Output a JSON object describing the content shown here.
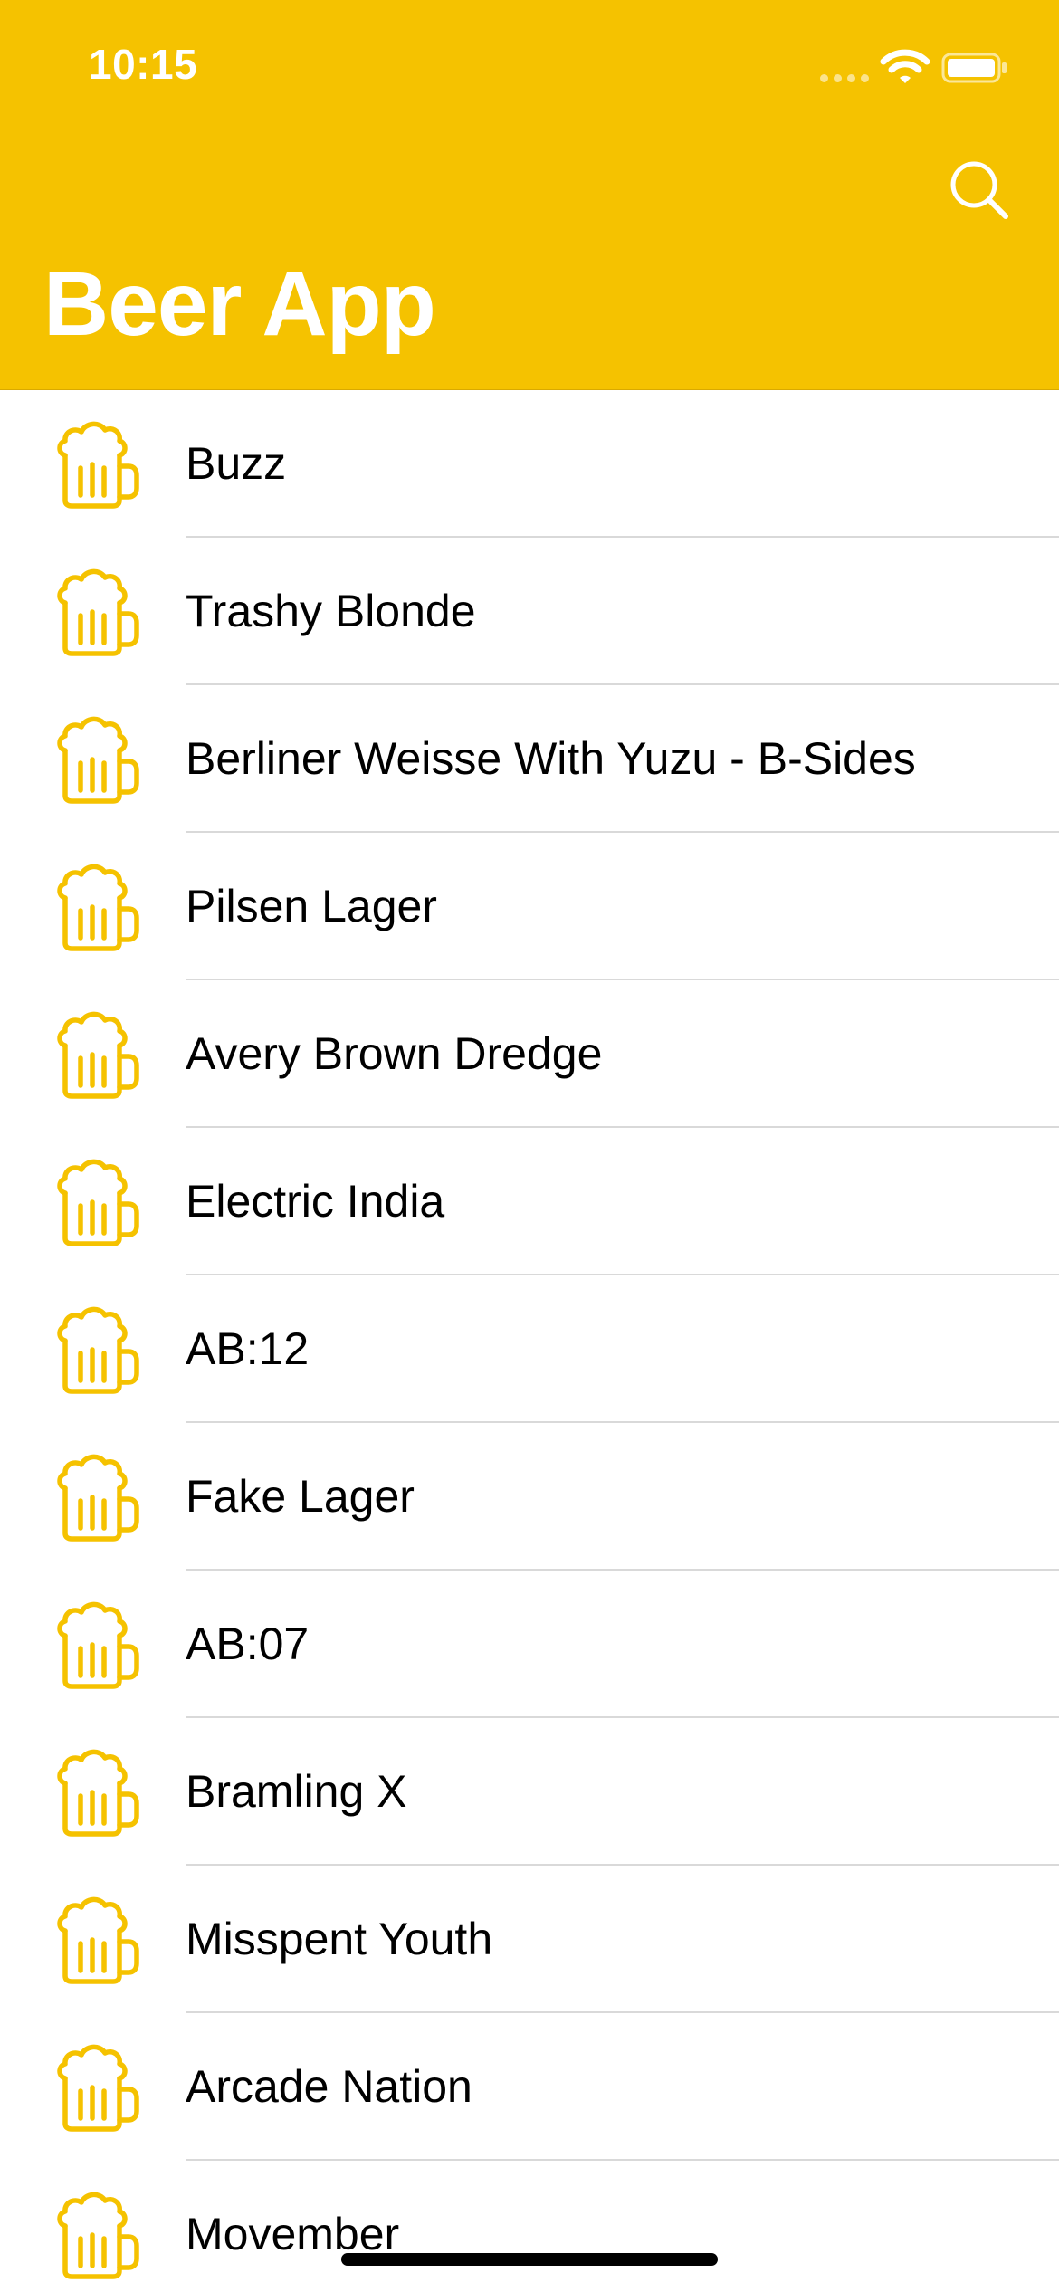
{
  "status_bar": {
    "time": "10:15",
    "signal_icon": "cellular-signal-icon",
    "wifi_icon": "wifi-icon",
    "battery_icon": "battery-icon"
  },
  "nav": {
    "title": "Beer App",
    "search_icon": "search-icon",
    "background_color": "#F5C200",
    "title_color": "#FFFFFF"
  },
  "beers": [
    {
      "name": "Buzz",
      "icon": "beer-mug-icon"
    },
    {
      "name": "Trashy Blonde",
      "icon": "beer-mug-icon"
    },
    {
      "name": "Berliner Weisse With Yuzu - B-Sides",
      "icon": "beer-mug-icon"
    },
    {
      "name": "Pilsen Lager",
      "icon": "beer-mug-icon"
    },
    {
      "name": "Avery Brown Dredge",
      "icon": "beer-mug-icon"
    },
    {
      "name": "Electric India",
      "icon": "beer-mug-icon"
    },
    {
      "name": "AB:12",
      "icon": "beer-mug-icon"
    },
    {
      "name": "Fake Lager",
      "icon": "beer-mug-icon"
    },
    {
      "name": "AB:07",
      "icon": "beer-mug-icon"
    },
    {
      "name": "Bramling X",
      "icon": "beer-mug-icon"
    },
    {
      "name": "Misspent Youth",
      "icon": "beer-mug-icon"
    },
    {
      "name": "Arcade Nation",
      "icon": "beer-mug-icon"
    },
    {
      "name": "Movember",
      "icon": "beer-mug-icon"
    }
  ],
  "colors": {
    "accent": "#F5C200",
    "icon": "#F5C200",
    "separator": "#D9D9D9",
    "text": "#000000"
  }
}
